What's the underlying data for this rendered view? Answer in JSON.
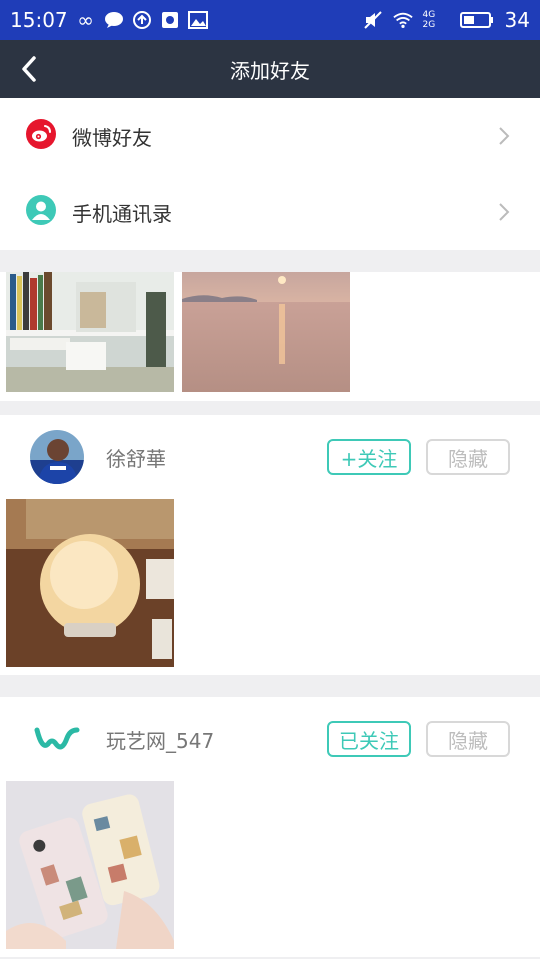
{
  "status": {
    "time": "15:07",
    "battery": "34",
    "network": "4G 2G"
  },
  "header": {
    "title": "添加好友"
  },
  "menu": [
    {
      "label": "微博好友"
    },
    {
      "label": "手机通讯录"
    }
  ],
  "users": [
    {
      "name": "徐舒華",
      "follow_label": "+关注",
      "hide_label": "隐藏"
    },
    {
      "name": "玩艺网_547",
      "follow_label": "已关注",
      "hide_label": "隐藏"
    }
  ],
  "colors": {
    "statusbar": "#1f3db8",
    "navbar": "#2c3442",
    "accent": "#3ec9b7",
    "weibo": "#e6162d"
  }
}
